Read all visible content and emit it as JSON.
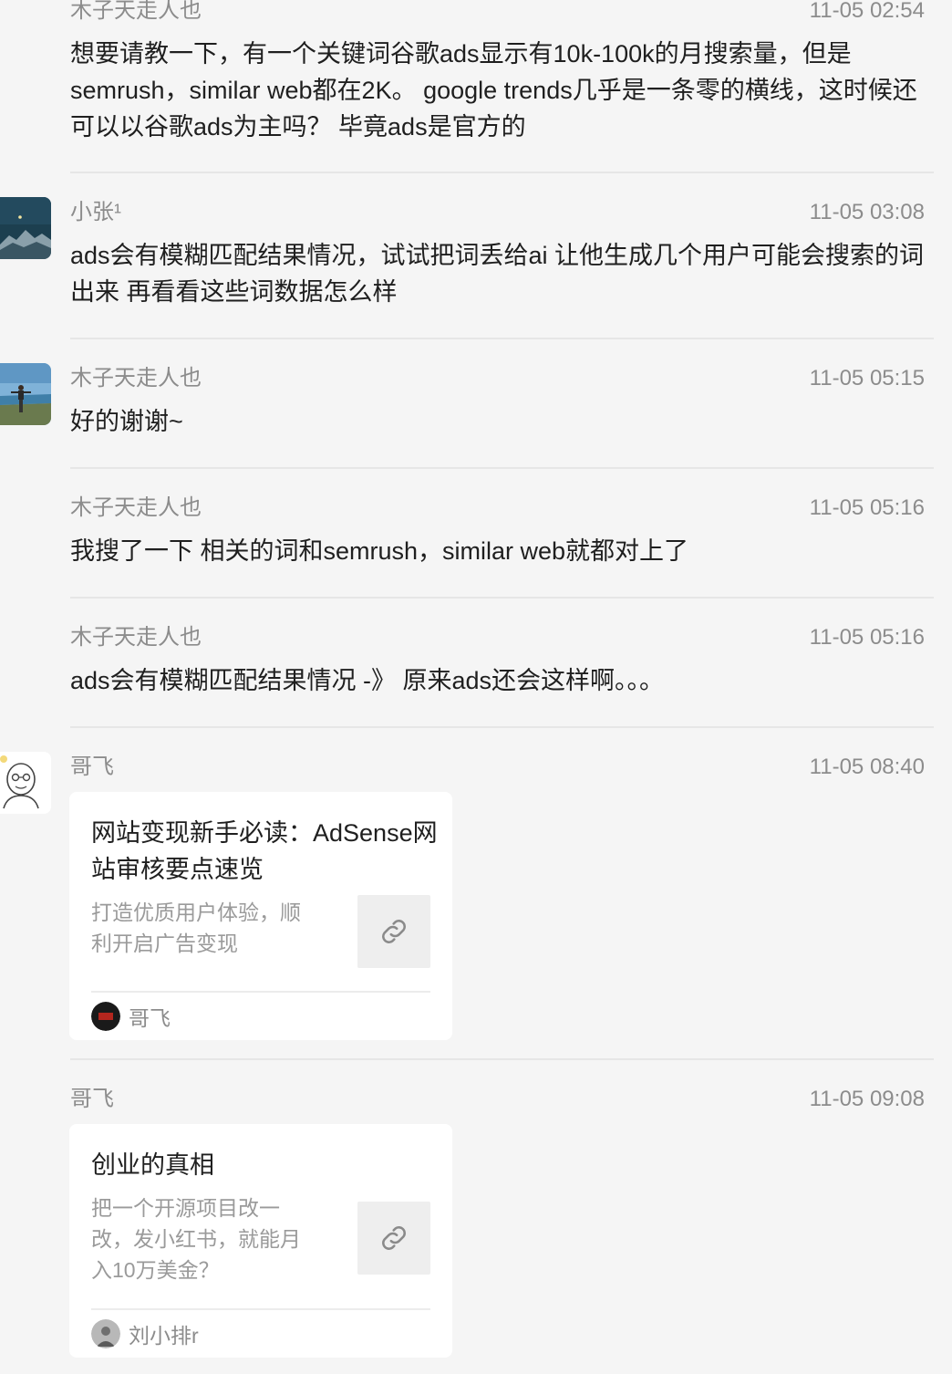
{
  "messages": [
    {
      "sender": "木子天走人也",
      "time": "11-05 02:54",
      "text": "想要请教一下，有一个关键词谷歌ads显示有10k-100k的月搜索量，但是semrush，similar web都在2K。 google trends几乎是一条零的横线，这时候还可以以谷歌ads为主吗？ 毕竟ads是官方的"
    },
    {
      "sender": "小张¹",
      "time": "11-05 03:08",
      "text": "ads会有模糊匹配结果情况，试试把词丢给ai 让他生成几个用户可能会搜索的词出来 再看看这些词数据怎么样"
    },
    {
      "sender": "木子天走人也",
      "time": "11-05 05:15",
      "text": "好的谢谢~"
    },
    {
      "sender": "木子天走人也",
      "time": "11-05 05:16",
      "text": "我搜了一下 相关的词和semrush，similar web就都对上了"
    },
    {
      "sender": "木子天走人也",
      "time": "11-05 05:16",
      "text": "ads会有模糊匹配结果情况 -》 原来ads还会这样啊。。。"
    },
    {
      "sender": "哥飞",
      "time": "11-05 08:40",
      "card": {
        "title": "网站变现新手必读：AdSense网站审核要点速览",
        "desc": "打造优质用户体验，顺利开启广告变现",
        "author": "哥飞",
        "thumb_icon": "link-icon"
      }
    },
    {
      "sender": "哥飞",
      "time": "11-05 09:08",
      "card": {
        "title": "创业的真相",
        "desc": "把一个开源项目改一改，发小红书，就能月入10万美金？",
        "author": "刘小排r",
        "thumb_icon": "link-icon"
      }
    }
  ],
  "colors": {
    "background": "#f5f5f5",
    "text": "#1f1f1f",
    "meta": "#8c8c8c",
    "card": "#ffffff"
  }
}
